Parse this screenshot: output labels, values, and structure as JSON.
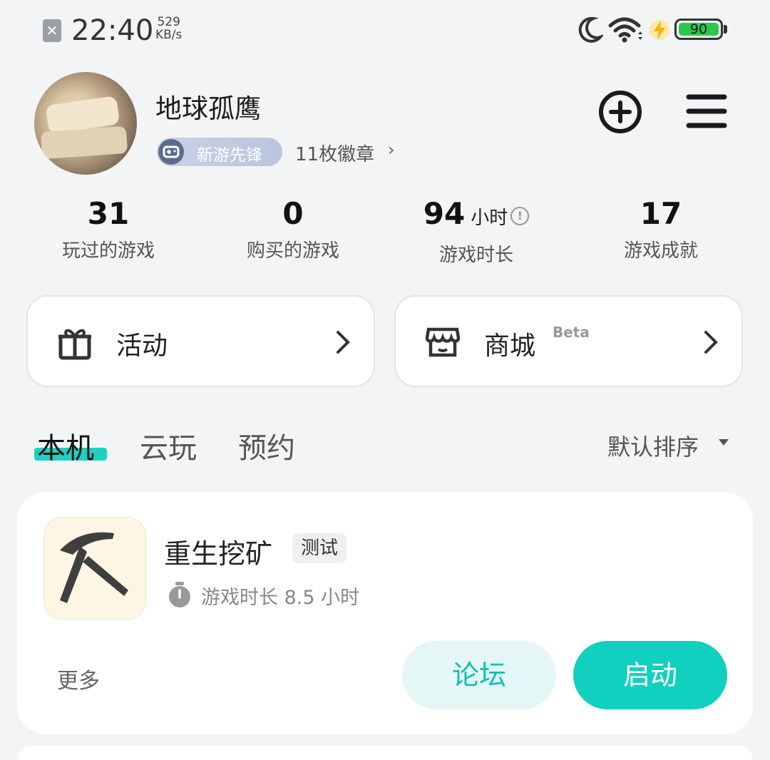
{
  "status_bar": {
    "time": "22:40",
    "net_speed_value": "529",
    "net_speed_unit": "KB/s",
    "battery": "90",
    "icons": [
      "notification-blocked-icon",
      "moon-icon",
      "wifi-icon",
      "charging-bolt-icon",
      "battery-icon"
    ]
  },
  "profile": {
    "username": "地球孤鹰",
    "badge_label": "新游先锋",
    "badge_count": "11枚徽章",
    "actions": [
      "add-circle-icon",
      "menu-icon"
    ]
  },
  "stats": [
    {
      "value": "31",
      "unit": "",
      "label": "玩过的游戏"
    },
    {
      "value": "0",
      "unit": "",
      "label": "购买的游戏"
    },
    {
      "value": "94",
      "unit": "小时",
      "label": "游戏时长"
    },
    {
      "value": "17",
      "unit": "",
      "label": "游戏成就"
    }
  ],
  "cards": {
    "activity": {
      "label": "活动",
      "icon": "gift-icon"
    },
    "store": {
      "label": "商城",
      "tag": "Beta",
      "icon": "store-icon"
    }
  },
  "tabs": {
    "items": [
      "本机",
      "云玩",
      "预约"
    ],
    "active": "本机",
    "sort_label": "默认排序"
  },
  "game": {
    "name": "重生挖矿",
    "tag": "测试",
    "playtime": "游戏时长 8.5 小时",
    "more_label": "更多",
    "forum_label": "论坛",
    "start_label": "启动",
    "icon": "pickaxe-icon"
  },
  "colors": {
    "accent": "#12d0c0",
    "accent_light": "#e4f7f6",
    "background": "#f3f4f5"
  }
}
